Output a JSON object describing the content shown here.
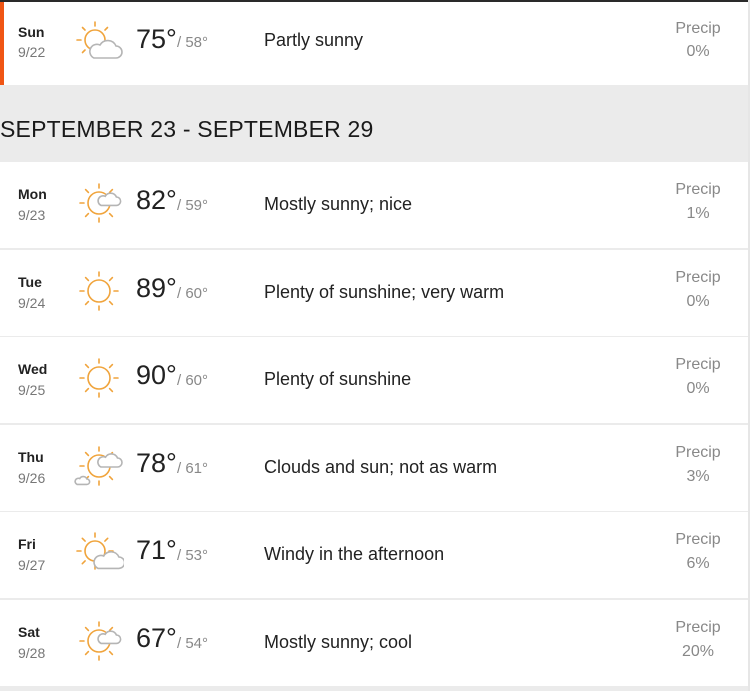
{
  "colors": {
    "accent": "#f05514",
    "sun": "#f0a43c",
    "cloud": "#b5b5b5"
  },
  "current_day": {
    "dow": "Sun",
    "date": "9/22",
    "icon": "partly-sunny-icon",
    "hi": "75°",
    "lo": "/ 58°",
    "phrase": "Partly sunny",
    "precip_label": "Precip",
    "precip": "0%"
  },
  "week": {
    "title": "SEPTEMBER 23 - SEPTEMBER 29",
    "days": [
      {
        "dow": "Mon",
        "date": "9/23",
        "icon": "mostly-sunny-icon",
        "hi": "82°",
        "lo": "/ 59°",
        "phrase": "Mostly sunny; nice",
        "precip_label": "Precip",
        "precip": "1%"
      },
      {
        "dow": "Tue",
        "date": "9/24",
        "icon": "sunny-icon",
        "hi": "89°",
        "lo": "/ 60°",
        "phrase": "Plenty of sunshine; very warm",
        "precip_label": "Precip",
        "precip": "0%"
      },
      {
        "dow": "Wed",
        "date": "9/25",
        "icon": "sunny-icon",
        "hi": "90°",
        "lo": "/ 60°",
        "phrase": "Plenty of sunshine",
        "precip_label": "Precip",
        "precip": "0%"
      },
      {
        "dow": "Thu",
        "date": "9/26",
        "icon": "clouds-and-sun-icon",
        "hi": "78°",
        "lo": "/ 61°",
        "phrase": "Clouds and sun; not as warm",
        "precip_label": "Precip",
        "precip": "3%"
      },
      {
        "dow": "Fri",
        "date": "9/27",
        "icon": "partly-sunny-icon",
        "hi": "71°",
        "lo": "/ 53°",
        "phrase": "Windy in the afternoon",
        "precip_label": "Precip",
        "precip": "6%"
      },
      {
        "dow": "Sat",
        "date": "9/28",
        "icon": "mostly-sunny-icon",
        "hi": "67°",
        "lo": "/ 54°",
        "phrase": "Mostly sunny; cool",
        "precip_label": "Precip",
        "precip": "20%"
      }
    ]
  }
}
